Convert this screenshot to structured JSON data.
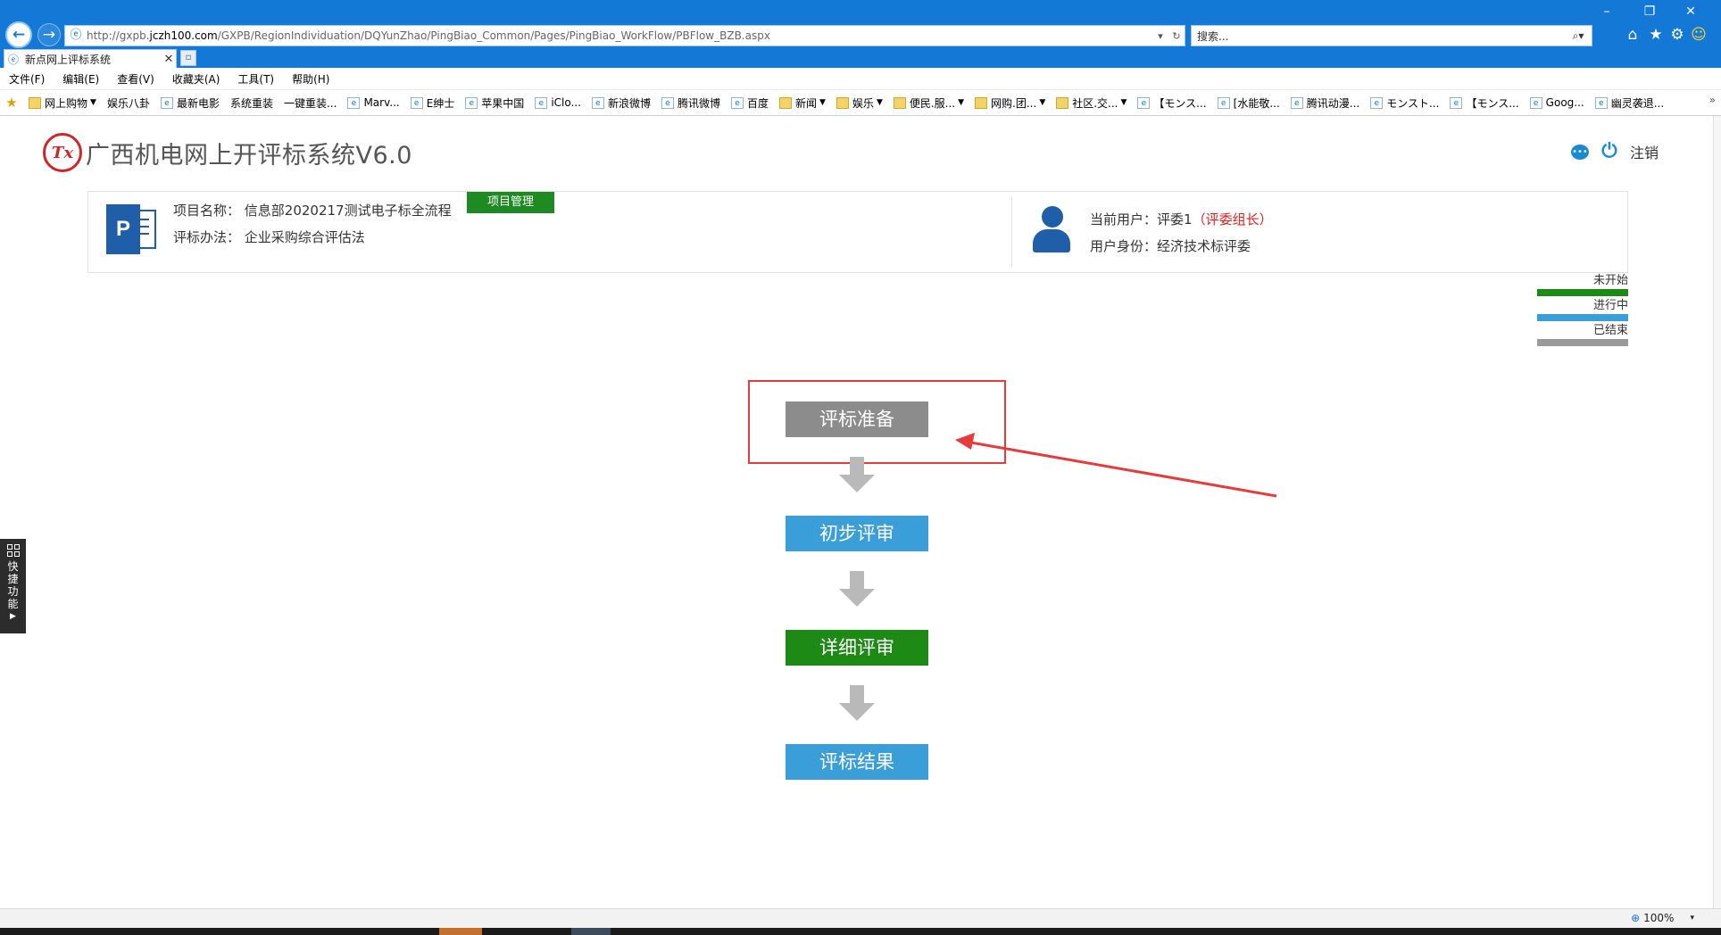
{
  "browser": {
    "url_prefix": "http://gxpb.",
    "url_host": "jczh100.com",
    "url_path": "/GXPB/RegionIndividuation/DQYunZhao/PingBiao_Common/Pages/PingBiao_WorkFlow/PBFlow_BZB.aspx",
    "search_placeholder": "搜索...",
    "tab_title": "新点网上评标系统",
    "window_controls": {
      "minimize": "–",
      "restore": "❐",
      "close": "✕"
    },
    "menu": [
      "文件(F)",
      "编辑(E)",
      "查看(V)",
      "收藏夹(A)",
      "工具(T)",
      "帮助(H)"
    ],
    "favorites": [
      {
        "label": "网上购物",
        "icon": "folder",
        "dropdown": true
      },
      {
        "label": "娱乐八卦",
        "icon": "none",
        "dropdown": false
      },
      {
        "label": "最新电影",
        "icon": "page",
        "dropdown": false
      },
      {
        "label": "系统重装",
        "icon": "none",
        "dropdown": false
      },
      {
        "label": "一键重装...",
        "icon": "none",
        "dropdown": false
      },
      {
        "label": "Marv...",
        "icon": "page",
        "dropdown": false
      },
      {
        "label": "E绅士",
        "icon": "page",
        "dropdown": false
      },
      {
        "label": "苹果中国",
        "icon": "page",
        "dropdown": false
      },
      {
        "label": "iClo...",
        "icon": "page",
        "dropdown": false
      },
      {
        "label": "新浪微博",
        "icon": "page",
        "dropdown": false
      },
      {
        "label": "腾讯微博",
        "icon": "page",
        "dropdown": false
      },
      {
        "label": "百度",
        "icon": "page",
        "dropdown": false
      },
      {
        "label": "新闻",
        "icon": "folder",
        "dropdown": true
      },
      {
        "label": "娱乐",
        "icon": "folder",
        "dropdown": true
      },
      {
        "label": "便民.服...",
        "icon": "folder",
        "dropdown": true
      },
      {
        "label": "网购.团...",
        "icon": "folder",
        "dropdown": true
      },
      {
        "label": "社区.交...",
        "icon": "folder",
        "dropdown": true
      },
      {
        "label": "【モンス...",
        "icon": "page",
        "dropdown": false
      },
      {
        "label": "[水能敬...",
        "icon": "page",
        "dropdown": false
      },
      {
        "label": "腾讯动漫...",
        "icon": "page",
        "dropdown": false
      },
      {
        "label": "モンスト...",
        "icon": "page",
        "dropdown": false
      },
      {
        "label": "【モンス...",
        "icon": "page",
        "dropdown": false
      },
      {
        "label": "Goog...",
        "icon": "page",
        "dropdown": false
      },
      {
        "label": "幽灵袭退...",
        "icon": "page",
        "dropdown": false
      }
    ],
    "zoom": "100%"
  },
  "app": {
    "logo_text": "Tx",
    "title": "广西机电网上开评标系统V6.0",
    "logout_label": "注销"
  },
  "project": {
    "name_label": "项目名称：",
    "name_value": "信息部2020217测试电子标全流程",
    "method_label": "评标办法：",
    "method_value": "企业采购综合评估法",
    "mgmt_button": "项目管理",
    "icon_letter": "P"
  },
  "user": {
    "current_label": "当前用户：",
    "current_value": "评委1",
    "role_open": "（",
    "role_tag": "评委组长",
    "role_close": "）",
    "identity_label": "用户身份：",
    "identity_value": "经济技术标评委"
  },
  "legend": [
    {
      "label": "未开始",
      "color": "#1e8a16"
    },
    {
      "label": "进行中",
      "color": "#3a9fd8"
    },
    {
      "label": "已结束",
      "color": "#9a9a9a"
    }
  ],
  "workflow": [
    {
      "label": "评标准备",
      "status": "已结束",
      "color": "#8c8c8c"
    },
    {
      "label": "初步评审",
      "status": "进行中",
      "color": "#3a9fd8"
    },
    {
      "label": "详细评审",
      "status": "未开始",
      "color": "#1e8a16"
    },
    {
      "label": "评标结果",
      "status": "进行中",
      "color": "#3a9fd8"
    }
  ],
  "quick_panel": {
    "label": [
      "快",
      "捷",
      "功",
      "能"
    ]
  }
}
